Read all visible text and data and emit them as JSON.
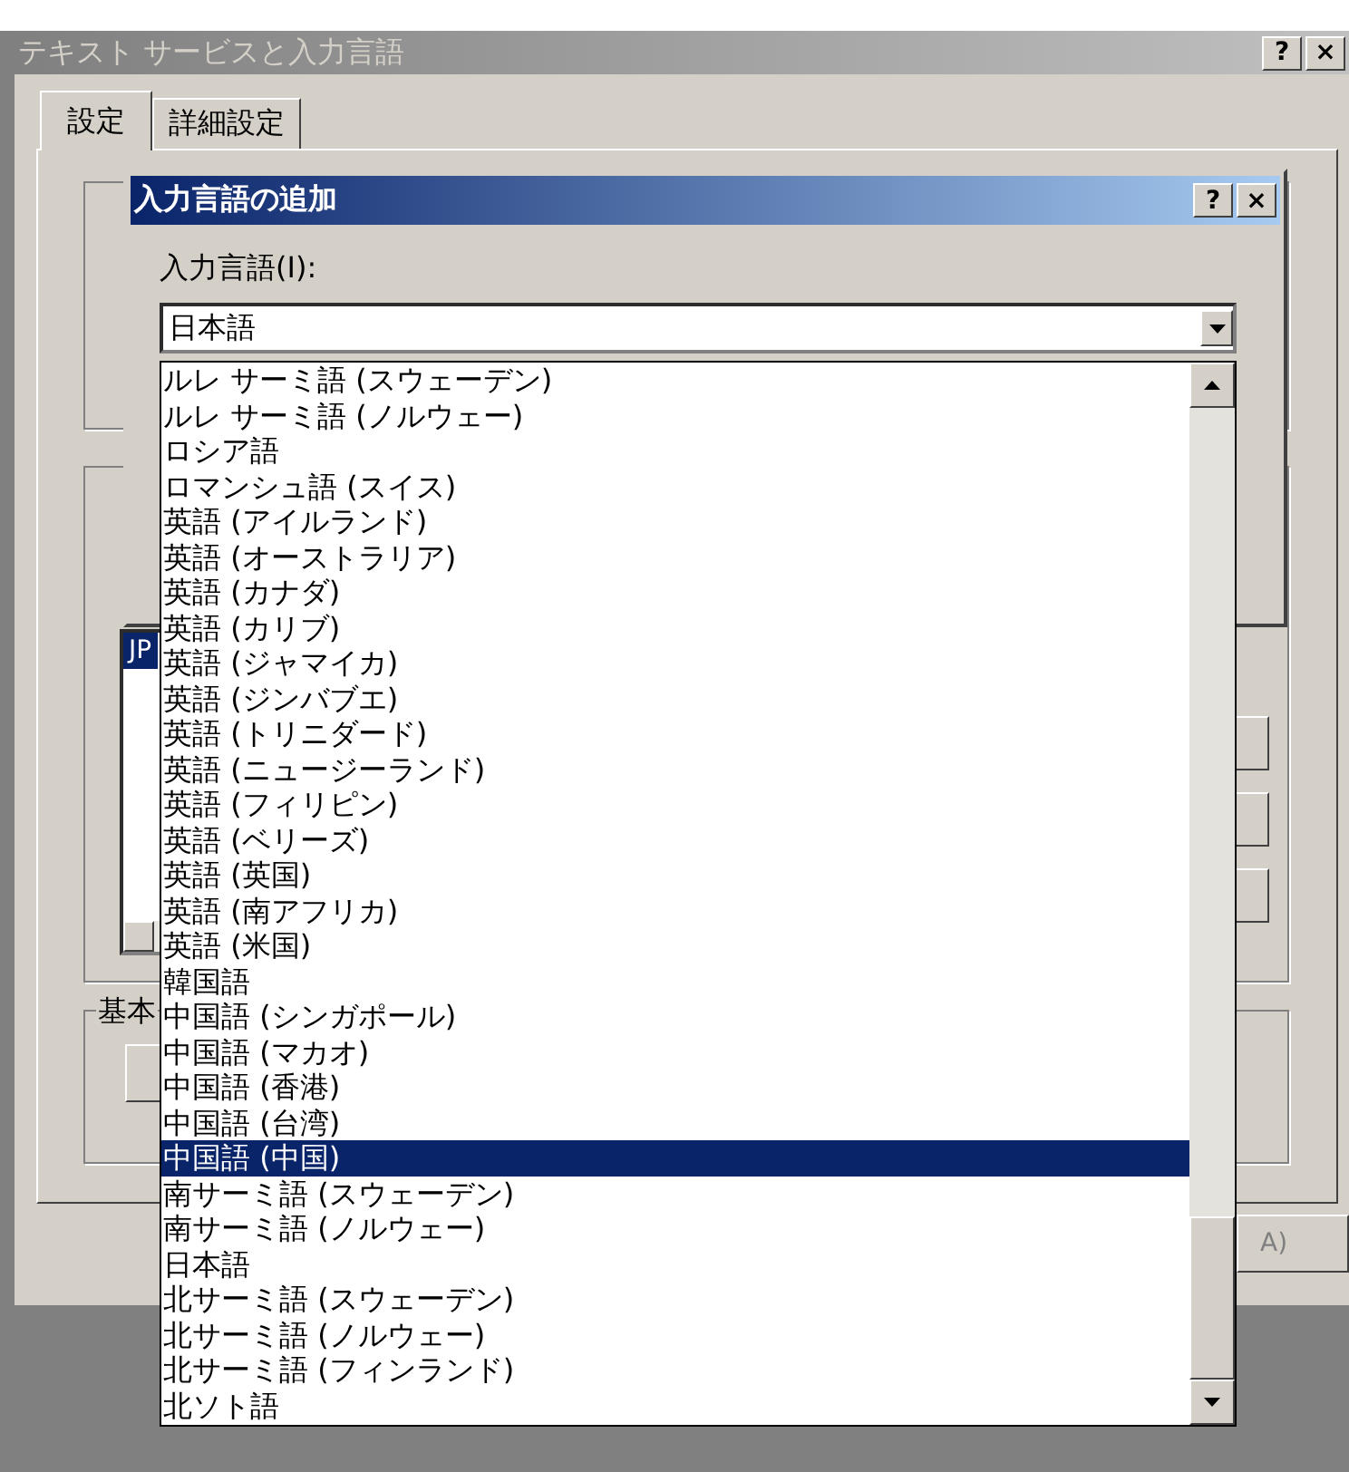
{
  "window": {
    "title": "テキスト サービスと入力言語",
    "active": false,
    "buttons": [
      "?",
      "×"
    ]
  },
  "tabs": [
    {
      "label": "設定",
      "selected": true
    },
    {
      "label": "詳細設定",
      "selected": false
    }
  ],
  "language_list": {
    "items": [
      {
        "label": "JP",
        "selected": true
      }
    ]
  },
  "group_3": {
    "label": "基本"
  },
  "footer_button": {
    "label": "A)"
  },
  "dialog": {
    "title": "入力言語の追加",
    "active": true,
    "buttons": [
      "?",
      "×"
    ],
    "field_label": "入力言語(I):",
    "value": "日本語",
    "dropdown": {
      "items": [
        {
          "label": "ルレ サーミ語 (スウェーデン)",
          "selected": false
        },
        {
          "label": "ルレ サーミ語 (ノルウェー)",
          "selected": false
        },
        {
          "label": "ロシア語",
          "selected": false
        },
        {
          "label": "ロマンシュ語 (スイス)",
          "selected": false
        },
        {
          "label": "英語 (アイルランド)",
          "selected": false
        },
        {
          "label": "英語 (オーストラリア)",
          "selected": false
        },
        {
          "label": "英語 (カナダ)",
          "selected": false
        },
        {
          "label": "英語 (カリブ)",
          "selected": false
        },
        {
          "label": "英語 (ジャマイカ)",
          "selected": false
        },
        {
          "label": "英語 (ジンバブエ)",
          "selected": false
        },
        {
          "label": "英語 (トリニダード)",
          "selected": false
        },
        {
          "label": "英語 (ニュージーランド)",
          "selected": false
        },
        {
          "label": "英語 (フィリピン)",
          "selected": false
        },
        {
          "label": "英語 (ベリーズ)",
          "selected": false
        },
        {
          "label": "英語 (英国)",
          "selected": false
        },
        {
          "label": "英語 (南アフリカ)",
          "selected": false
        },
        {
          "label": "英語 (米国)",
          "selected": false
        },
        {
          "label": "韓国語",
          "selected": false
        },
        {
          "label": "中国語 (シンガポール)",
          "selected": false
        },
        {
          "label": "中国語 (マカオ)",
          "selected": false
        },
        {
          "label": "中国語 (香港)",
          "selected": false
        },
        {
          "label": "中国語 (台湾)",
          "selected": false
        },
        {
          "label": "中国語 (中国)",
          "selected": true
        },
        {
          "label": "南サーミ語 (スウェーデン)",
          "selected": false
        },
        {
          "label": "南サーミ語 (ノルウェー)",
          "selected": false
        },
        {
          "label": "日本語",
          "selected": false
        },
        {
          "label": "北サーミ語 (スウェーデン)",
          "selected": false
        },
        {
          "label": "北サーミ語 (ノルウェー)",
          "selected": false
        },
        {
          "label": "北サーミ語 (フィンランド)",
          "selected": false
        },
        {
          "label": "北ソト語",
          "selected": false
        }
      ]
    }
  }
}
